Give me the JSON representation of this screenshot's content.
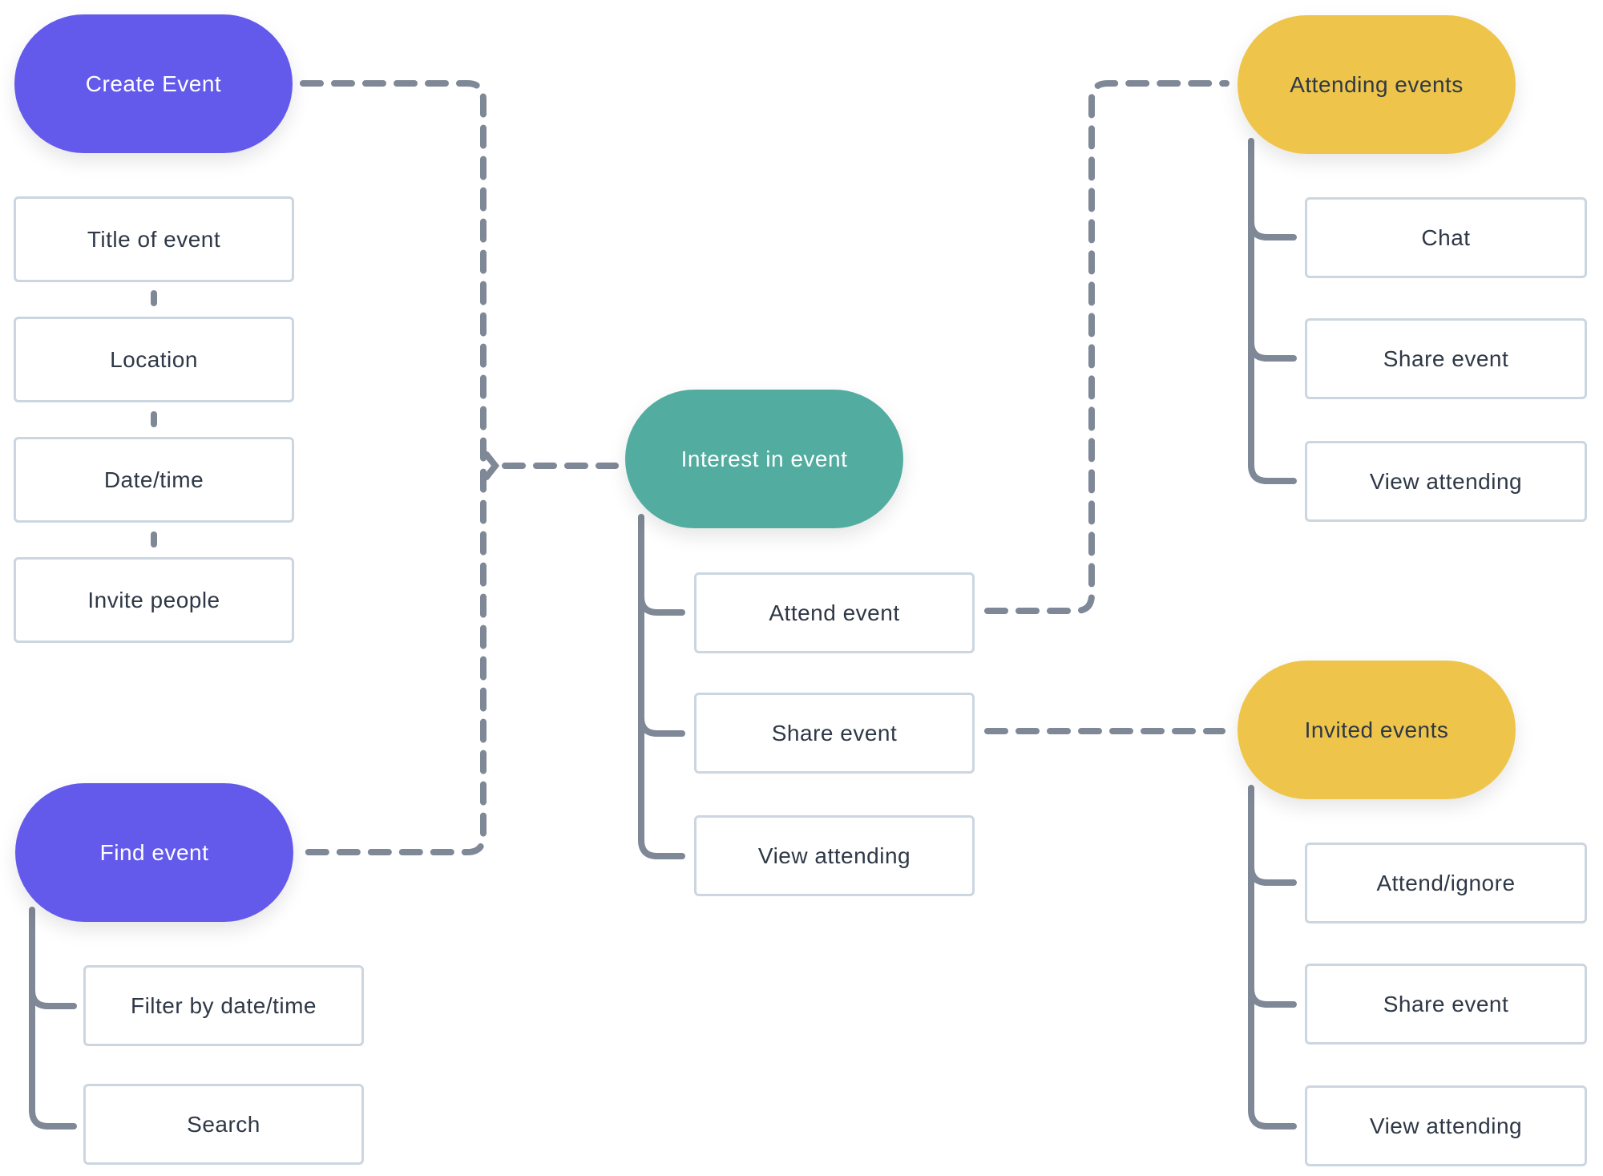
{
  "colors": {
    "primary": "#635AEB",
    "interest": "#52ACA0",
    "secondary": "#EEC54A",
    "connector": "#7F8896",
    "box_border": "#CCD6E0",
    "text": "#2E3846"
  },
  "nodes": {
    "create_event": {
      "label": "Create Event",
      "steps": [
        "Title of event",
        "Location",
        "Date/time",
        "Invite people"
      ]
    },
    "find_event": {
      "label": "Find event",
      "children": [
        "Filter by date/time",
        "Search"
      ]
    },
    "interest_in_event": {
      "label": "Interest in event",
      "children": [
        "Attend event",
        "Share event",
        "View attending"
      ]
    },
    "attending_events": {
      "label": "Attending events",
      "children": [
        "Chat",
        "Share event",
        "View attending"
      ]
    },
    "invited_events": {
      "label": "Invited events",
      "children": [
        "Attend/ignore",
        "Share event",
        "View attending"
      ]
    }
  },
  "edges": [
    {
      "from": "Create Event",
      "to": "Interest in event",
      "style": "dashed"
    },
    {
      "from": "Find event",
      "to": "Interest in event",
      "style": "dashed"
    },
    {
      "from": "Attend event",
      "to": "Attending events",
      "style": "dashed"
    },
    {
      "from": "Share event",
      "to": "Invited events",
      "style": "dashed"
    }
  ]
}
